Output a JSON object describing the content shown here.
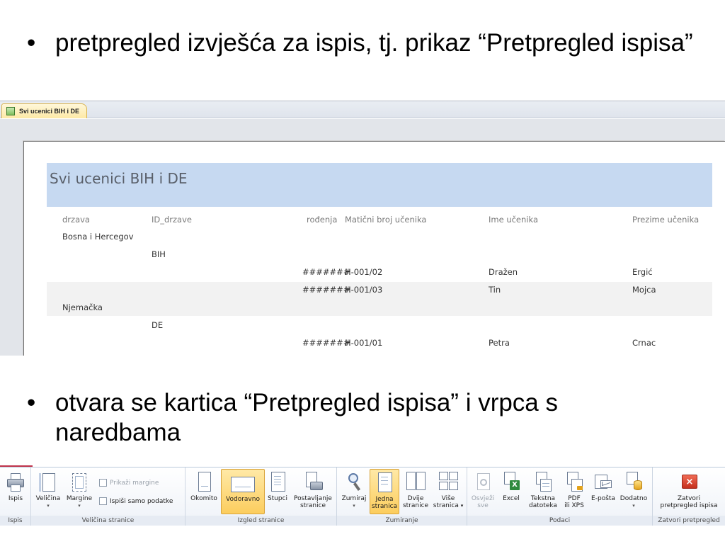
{
  "slide": {
    "bullet1": "pretpregled izvješća za ispis, tj. prikaz “Pretpregled ispisa”",
    "bullet2": "otvara se kartica “Pretpregled ispisa” i vrpca s naredbama",
    "bullet_symbol": "•"
  },
  "document": {
    "tab_label": "Svi ucenici BIH i DE",
    "tab_icon": "report-icon",
    "report_title": "Svi ucenici BIH i DE",
    "columns": [
      "drzava",
      "ID_drzave",
      "rođenja",
      "Matični broj učenika",
      "Ime učenika",
      "Prezime učenika"
    ],
    "rows": [
      {
        "drzava": "Bosna i Hercegov"
      },
      {
        "id": "BIH"
      },
      {
        "rodenja": "#######",
        "maticni": "H-001/02",
        "ime": "Dražen",
        "prezime": "Ergić"
      },
      {
        "rodenja": "#######",
        "maticni": "H-001/03",
        "ime": "Tin",
        "prezime": "Mojca"
      },
      {
        "drzava": "Njemačka"
      },
      {
        "id": "DE"
      },
      {
        "rodenja": "#######",
        "maticni": "H-001/01",
        "ime": "Petra",
        "prezime": "Crnac"
      }
    ]
  },
  "ribbon": {
    "groups": {
      "ispis": "Ispis",
      "velicina": "Veličina stranice",
      "izgled": "Izgled stranice",
      "zumiranje": "Zumiranje",
      "podaci": "Podaci",
      "zatvori": "Zatvori pretpregled"
    },
    "buttons": {
      "ispis": "Ispis",
      "velicina": "Veličina",
      "margine": "Margine",
      "prikazi_margine": "Prikaži margine",
      "ispisi_samo_podatke": "Ispiši samo podatke",
      "okomito": "Okomito",
      "vodoravno": "Vodoravno",
      "stupci": "Stupci",
      "postavljanje1": "Postavljanje",
      "postavljanje2": "stranice",
      "zumiraj": "Zumiraj",
      "jedna1": "Jedna",
      "jedna2": "stranica",
      "dvije1": "Dvije",
      "dvije2": "stranice",
      "vise1": "Više",
      "vise2": "stranica",
      "osvjezi1": "Osvježi",
      "osvjezi2": "sve",
      "excel": "Excel",
      "tekstna1": "Tekstna",
      "tekstna2": "datoteka",
      "pdf1": "PDF",
      "pdf2": "ili XPS",
      "eposta": "E-pošta",
      "dodatno": "Dodatno",
      "zatvori1": "Zatvori",
      "zatvori2": "pretpregled ispisa"
    },
    "dropdown_glyph": "▾",
    "active_buttons": [
      "vodoravno",
      "jedna-stranica"
    ],
    "accent_color": "#fccd5e",
    "close_color": "#d9412c"
  }
}
